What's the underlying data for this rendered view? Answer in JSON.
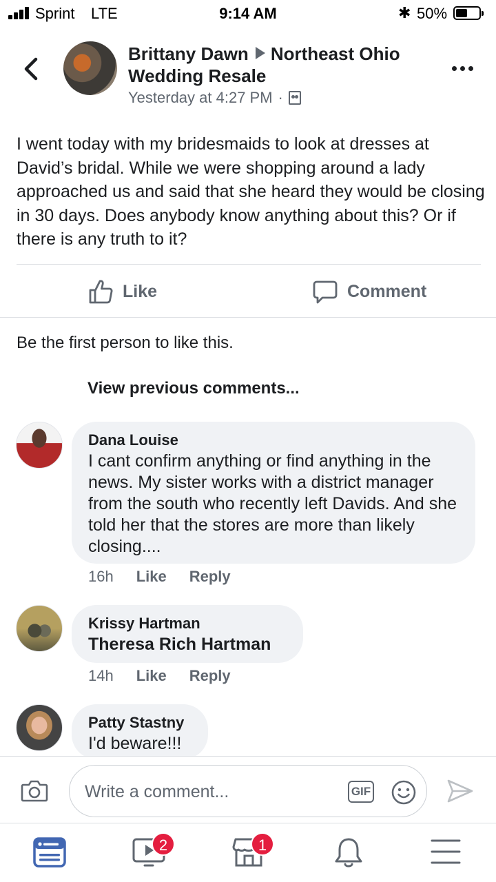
{
  "status_bar": {
    "carrier": "Sprint",
    "network": "LTE",
    "time": "9:14 AM",
    "battery_percent": "50%",
    "battery_level": 0.5,
    "icons": [
      "signal-icon",
      "bluetooth-icon",
      "battery-icon"
    ]
  },
  "post": {
    "author": "Brittany Dawn",
    "group": "Northeast Ohio Wedding Resale",
    "timestamp": "Yesterday at 4:27 PM",
    "separator": "·",
    "body": "I went today with my bridesmaids to look at dresses at David’s bridal. While we were shopping around a lady approached us and said that she heard they would be closing in 30 days. Does anybody know anything about this? Or if there is any truth to it?",
    "actions": {
      "like": "Like",
      "comment": "Comment"
    },
    "likes_text": "Be the first person to like this.",
    "view_previous": "View previous comments..."
  },
  "comments": [
    {
      "name": "Dana Louise",
      "text": "I cant confirm anything or find anything in the news. My sister works with a district manager from the south who recently left Davids. And she told her that the stores are more than likely closing....",
      "time": "16h",
      "like": "Like",
      "reply": "Reply"
    },
    {
      "name": "Krissy Hartman",
      "text": "Theresa Rich Hartman",
      "time": "14h",
      "like": "Like",
      "reply": "Reply"
    },
    {
      "name": "Patty Stastny",
      "text": "I'd beware!!!"
    }
  ],
  "composer": {
    "placeholder": "Write a comment...",
    "gif_label": "GIF"
  },
  "nav": {
    "video_badge": "2",
    "marketplace_badge": "1"
  },
  "colors": {
    "text": "#1c1e21",
    "secondary": "#606770",
    "bubble": "#f0f2f5",
    "active_tab": "#4267b2",
    "badge": "#e41e3f"
  }
}
